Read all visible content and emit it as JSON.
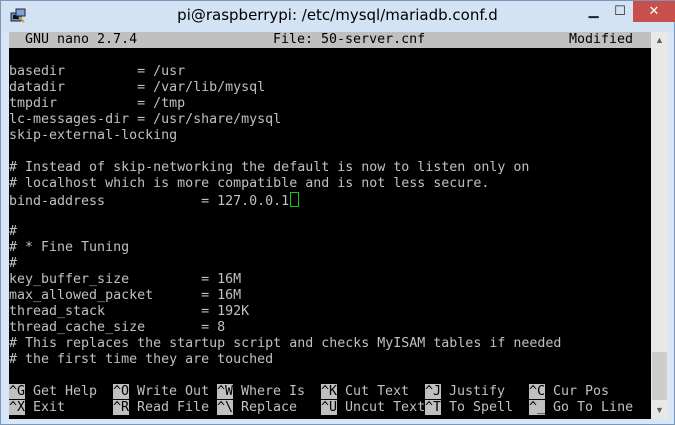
{
  "window": {
    "title": "pi@raspberrypi: /etc/mysql/mariadb.conf.d"
  },
  "nano": {
    "version": "GNU nano 2.7.4",
    "file": "File: 50-server.cnf",
    "status": "Modified"
  },
  "lines": [
    "",
    "basedir         = /usr",
    "datadir         = /var/lib/mysql",
    "tmpdir          = /tmp",
    "lc-messages-dir = /usr/share/mysql",
    "skip-external-locking",
    "",
    "# Instead of skip-networking the default is now to listen only on",
    "# localhost which is more compatible and is not less secure.",
    "bind-address            = 127.0.0.1",
    "",
    "#",
    "# * Fine Tuning",
    "#",
    "key_buffer_size         = 16M",
    "max_allowed_packet      = 16M",
    "thread_stack            = 192K",
    "thread_cache_size       = 8",
    "# This replaces the startup script and checks MyISAM tables if needed",
    "# the first time they are touched"
  ],
  "shortcuts": [
    {
      "key": "^G",
      "label": " Get Help"
    },
    {
      "key": "^O",
      "label": " Write Out"
    },
    {
      "key": "^W",
      "label": " Where Is"
    },
    {
      "key": "^K",
      "label": " Cut Text"
    },
    {
      "key": "^J",
      "label": " Justify"
    },
    {
      "key": "^C",
      "label": " Cur Pos"
    },
    {
      "key": "^X",
      "label": " Exit"
    },
    {
      "key": "^R",
      "label": " Read File"
    },
    {
      "key": "^\\",
      "label": " Replace"
    },
    {
      "key": "^U",
      "label": " Uncut Text"
    },
    {
      "key": "^T",
      "label": " To Spell"
    },
    {
      "key": "^_",
      "label": " Go To Line"
    }
  ],
  "icons": {
    "app": "putty-icon",
    "minimize": "minimize-icon",
    "maximize": "maximize-icon",
    "close": "close-icon"
  },
  "colors": {
    "terminal_bg": "#000000",
    "terminal_fg": "#c0c0c0",
    "close_button": "#c7504c",
    "cursor": "#20c020"
  }
}
